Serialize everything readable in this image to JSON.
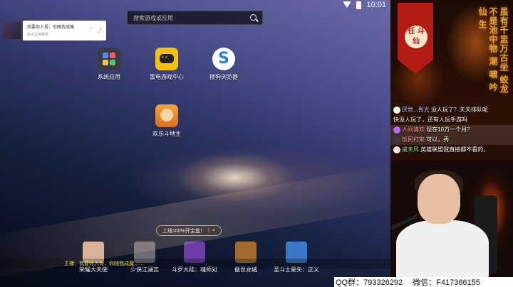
{
  "status_bar": {
    "time": "10:01"
  },
  "search": {
    "placeholder": "搜索游戏或应用"
  },
  "notification": {
    "title": "我要你入骨，你随我成魔",
    "subtitle": "来自主播推荐"
  },
  "apps": [
    {
      "label": "系统应用",
      "icon": "system-apps-icon"
    },
    {
      "label": "雷电游戏中心",
      "icon": "gamepad-icon"
    },
    {
      "label": "搜狗浏览器",
      "icon": "browser-icon"
    },
    {
      "label": "欢乐斗地主",
      "icon": "doudizhu-icon"
    }
  ],
  "promo_tip": {
    "text": "上线100%开宝盒！",
    "close": "×"
  },
  "dock": [
    {
      "label": "荣耀大天使",
      "color": "#d9b49a"
    },
    {
      "label": "少侠江湖志",
      "color": "#6d6e74"
    },
    {
      "label": "斗罗大陆：魂师对",
      "color": "#6b3fa6"
    },
    {
      "label": "傲世龙城",
      "color": "#a36a2e"
    },
    {
      "label": "圣斗士星矢：正义",
      "color": "#3c78c8"
    }
  ],
  "ticker": {
    "text": "主播：我要你入骨，你随我成魔……"
  },
  "stream": {
    "banner": "任 斗 仙",
    "poem": "虽有千盅万古坐 蛟龙不是池中物 潮 啸 吟 仙 生",
    "chat": [
      {
        "user": "厌世...畏光",
        "text": "没人玩了？天天排队呢",
        "style": "u"
      },
      {
        "user": "",
        "text": "快没人玩了，还有人玩手游吗",
        "style": "u"
      },
      {
        "user": "人间清欢",
        "text": "现在10万一个月？",
        "style": "u2"
      },
      {
        "user": "饭民打架",
        "text": "可以，秀",
        "style": "u2"
      },
      {
        "user": "戚未风",
        "text": "英雄联盟我直接都不看的，",
        "style": "u3"
      }
    ]
  },
  "contact": {
    "qq": "QQ群：793326292",
    "wechat": "微信：F417386155"
  }
}
